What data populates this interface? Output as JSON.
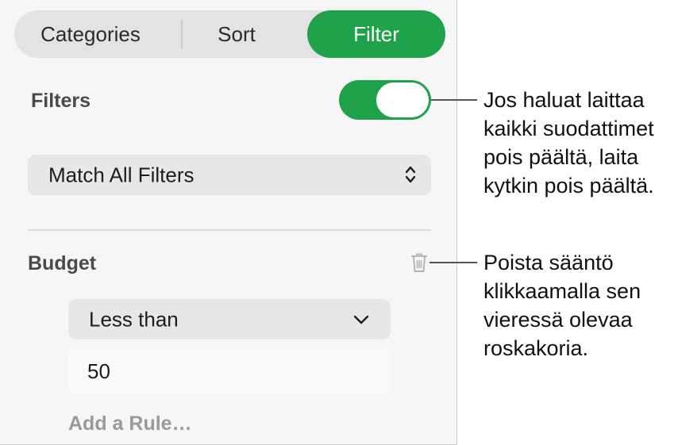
{
  "tabs": [
    {
      "label": "Categories",
      "active": false
    },
    {
      "label": "Sort",
      "active": false
    },
    {
      "label": "Filter",
      "active": true
    }
  ],
  "filters": {
    "label": "Filters",
    "enabled": true,
    "match_value": "Match All Filters"
  },
  "rule": {
    "name": "Budget",
    "condition": "Less than",
    "value": "50"
  },
  "add_rule_label": "Add a Rule…",
  "callouts": {
    "toggle": [
      "Jos haluat laittaa",
      "kaikki suodattimet",
      "pois päältä, laita",
      "kytkin pois päältä."
    ],
    "trash": [
      "Poista sääntö",
      "klikkaamalla sen",
      "vieressä olevaa",
      "roskakoria."
    ]
  },
  "colors": {
    "accent": "#1fa24a",
    "panel": "#f6f6f6"
  }
}
